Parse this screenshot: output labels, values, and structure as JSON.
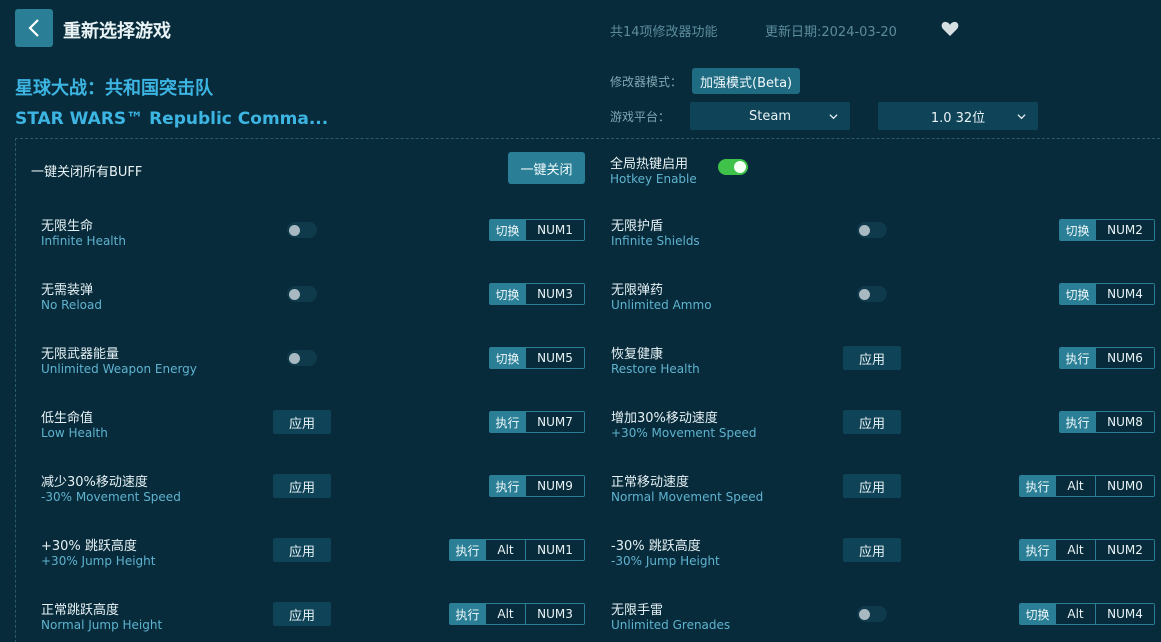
{
  "header": {
    "title": "重新选择游戏",
    "count": "共14项修改器功能",
    "date": "更新日期:2024-03-20"
  },
  "game": {
    "name_cn": "星球大战：共和国突击队",
    "name_en": "STAR WARS™ Republic Comma..."
  },
  "settings": {
    "mode_label": "修改器模式：",
    "mode_value": "加强模式(Beta)",
    "platform_label": "游戏平台：",
    "platform_value": "Steam",
    "version_value": "1.0 32位"
  },
  "controls": {
    "buff_label": "一键关闭所有BUFF",
    "close_all": "一键关闭",
    "hotkey_cn": "全局热键启用",
    "hotkey_en": "Hotkey Enable"
  },
  "cheats": [
    {
      "cn": "无限生命",
      "en": "Infinite Health",
      "control": "toggle",
      "action": "切换",
      "keys": [
        "NUM1"
      ]
    },
    {
      "cn": "无限护盾",
      "en": "Infinite Shields",
      "control": "toggle",
      "action": "切换",
      "keys": [
        "NUM2"
      ]
    },
    {
      "cn": "无需装弹",
      "en": "No Reload",
      "control": "toggle",
      "action": "切换",
      "keys": [
        "NUM3"
      ]
    },
    {
      "cn": "无限弹药",
      "en": "Unlimited Ammo",
      "control": "toggle",
      "action": "切换",
      "keys": [
        "NUM4"
      ]
    },
    {
      "cn": "无限武器能量",
      "en": "Unlimited Weapon Energy",
      "control": "toggle",
      "action": "切换",
      "keys": [
        "NUM5"
      ]
    },
    {
      "cn": "恢复健康",
      "en": "Restore Health",
      "control": "apply",
      "action": "执行",
      "keys": [
        "NUM6"
      ]
    },
    {
      "cn": "低生命值",
      "en": "Low Health",
      "control": "apply",
      "action": "执行",
      "keys": [
        "NUM7"
      ]
    },
    {
      "cn": "增加30%移动速度",
      "en": "+30% Movement Speed",
      "control": "apply",
      "action": "执行",
      "keys": [
        "NUM8"
      ]
    },
    {
      "cn": "减少30%移动速度",
      "en": "-30% Movement Speed",
      "control": "apply",
      "action": "执行",
      "keys": [
        "NUM9"
      ]
    },
    {
      "cn": "正常移动速度",
      "en": "Normal Movement Speed",
      "control": "apply",
      "action": "执行",
      "keys": [
        "Alt",
        "NUM0"
      ]
    },
    {
      "cn": "+30% 跳跃高度",
      "en": "+30% Jump Height",
      "control": "apply",
      "action": "执行",
      "keys": [
        "Alt",
        "NUM1"
      ]
    },
    {
      "cn": "-30% 跳跃高度",
      "en": "-30% Jump Height",
      "control": "apply",
      "action": "执行",
      "keys": [
        "Alt",
        "NUM2"
      ]
    },
    {
      "cn": "正常跳跃高度",
      "en": "Normal Jump Height",
      "control": "apply",
      "action": "执行",
      "keys": [
        "Alt",
        "NUM3"
      ]
    },
    {
      "cn": "无限手雷",
      "en": "Unlimited Grenades",
      "control": "toggle",
      "action": "切换",
      "keys": [
        "Alt",
        "NUM4"
      ]
    }
  ],
  "apply_label": "应用",
  "colors": {
    "background": "#072b3a",
    "accent": "#2a7f96",
    "title_blue": "#3db5e3",
    "toggle_on": "#3ec24a"
  }
}
